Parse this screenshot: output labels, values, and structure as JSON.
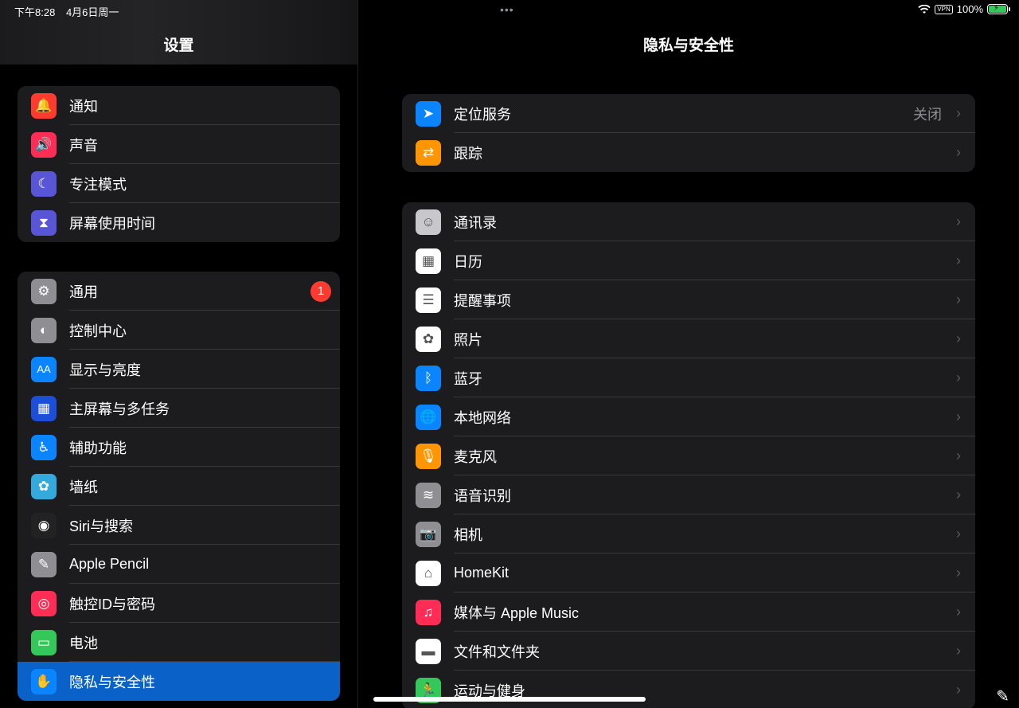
{
  "status_bar": {
    "time": "下午8:28",
    "date": "4月6日周一",
    "vpn": "VPN",
    "battery": "100%",
    "multitask": "•••"
  },
  "sidebar": {
    "title": "设置",
    "group1": [
      {
        "label": "通知",
        "icon": "bell-icon",
        "color": "#ff3b30",
        "glyph": "🔔"
      },
      {
        "label": "声音",
        "icon": "speaker-icon",
        "color": "#ff2d55",
        "glyph": "🔊"
      },
      {
        "label": "专注模式",
        "icon": "moon-icon",
        "color": "#5856d6",
        "glyph": "☾"
      },
      {
        "label": "屏幕使用时间",
        "icon": "hourglass-icon",
        "color": "#5856d6",
        "glyph": "⧗"
      }
    ],
    "group2": [
      {
        "label": "通用",
        "icon": "gear-icon",
        "color": "#8e8e93",
        "glyph": "⚙",
        "badge": "1"
      },
      {
        "label": "控制中心",
        "icon": "toggles-icon",
        "color": "#8e8e93",
        "glyph": "◐"
      },
      {
        "label": "显示与亮度",
        "icon": "text-size-icon",
        "color": "#0a84ff",
        "glyph": "AA"
      },
      {
        "label": "主屏幕与多任务",
        "icon": "home-grid-icon",
        "color": "#1d4ed8",
        "glyph": "▦"
      },
      {
        "label": "辅助功能",
        "icon": "accessibility-icon",
        "color": "#0a84ff",
        "glyph": "♿"
      },
      {
        "label": "墙纸",
        "icon": "flower-icon",
        "color": "#34aadc",
        "glyph": "✿"
      },
      {
        "label": "Siri与搜索",
        "icon": "siri-icon",
        "color": "#222",
        "glyph": "◉"
      },
      {
        "label": "Apple Pencil",
        "icon": "pencil-icon",
        "color": "#8e8e93",
        "glyph": "✎"
      },
      {
        "label": "触控ID与密码",
        "icon": "fingerprint-icon",
        "color": "#ff2d55",
        "glyph": "◎"
      },
      {
        "label": "电池",
        "icon": "battery-icon",
        "color": "#34c759",
        "glyph": "▭"
      },
      {
        "label": "隐私与安全性",
        "icon": "hand-icon",
        "color": "#0a84ff",
        "glyph": "✋",
        "selected": true
      }
    ]
  },
  "detail": {
    "title": "隐私与安全性",
    "group1": [
      {
        "label": "定位服务",
        "icon": "location-arrow-icon",
        "color": "#0a84ff",
        "glyph": "➤",
        "value": "关闭"
      },
      {
        "label": "跟踪",
        "icon": "tracking-icon",
        "color": "#ff9500",
        "glyph": "⇄"
      }
    ],
    "group2": [
      {
        "label": "通讯录",
        "icon": "contacts-icon",
        "color": "#c7c7cc",
        "glyph": "☺"
      },
      {
        "label": "日历",
        "icon": "calendar-icon",
        "color": "#ffffff",
        "glyph": "▦"
      },
      {
        "label": "提醒事项",
        "icon": "reminders-icon",
        "color": "#ffffff",
        "glyph": "☰"
      },
      {
        "label": "照片",
        "icon": "photos-icon",
        "color": "#ffffff",
        "glyph": "✿"
      },
      {
        "label": "蓝牙",
        "icon": "bluetooth-icon",
        "color": "#0a84ff",
        "glyph": "ᛒ"
      },
      {
        "label": "本地网络",
        "icon": "globe-icon",
        "color": "#0a84ff",
        "glyph": "🌐"
      },
      {
        "label": "麦克风",
        "icon": "microphone-icon",
        "color": "#ff9500",
        "glyph": "🎙"
      },
      {
        "label": "语音识别",
        "icon": "waveform-icon",
        "color": "#8e8e93",
        "glyph": "≋"
      },
      {
        "label": "相机",
        "icon": "camera-icon",
        "color": "#8e8e93",
        "glyph": "📷"
      },
      {
        "label": "HomeKit",
        "icon": "house-icon",
        "color": "#ffffff",
        "glyph": "⌂"
      },
      {
        "label": "媒体与 Apple Music",
        "icon": "music-note-icon",
        "color": "#ff2d55",
        "glyph": "♫"
      },
      {
        "label": "文件和文件夹",
        "icon": "folder-icon",
        "color": "#ffffff",
        "glyph": "▬"
      },
      {
        "label": "运动与健身",
        "icon": "runner-icon",
        "color": "#34c759",
        "glyph": "🏃"
      }
    ]
  }
}
